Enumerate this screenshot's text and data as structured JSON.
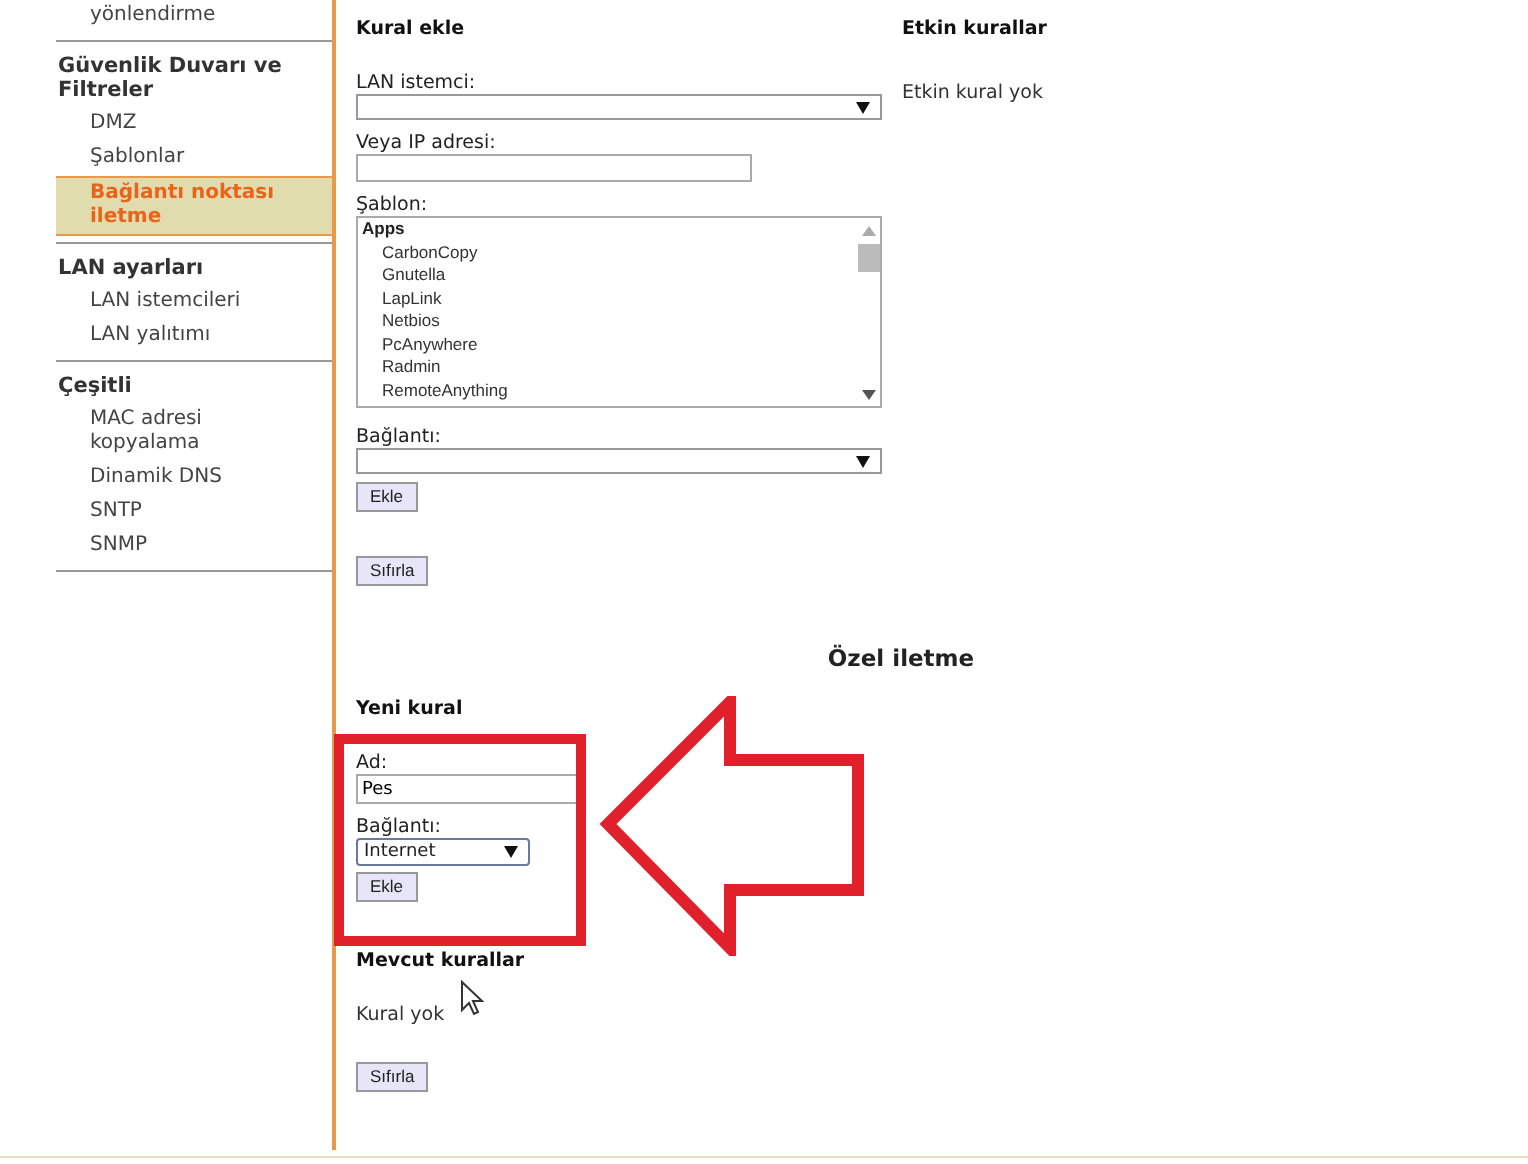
{
  "sidebar": {
    "sections": [
      {
        "items": [
          {
            "label": "yönlendirme",
            "selected": false
          }
        ]
      },
      {
        "title": "Güvenlik Duvarı ve Filtreler",
        "items": [
          {
            "label": "DMZ",
            "selected": false
          },
          {
            "label": "Şablonlar",
            "selected": false
          },
          {
            "label": "Bağlantı noktası iletme",
            "selected": true
          }
        ]
      },
      {
        "title": "LAN ayarları",
        "items": [
          {
            "label": "LAN istemcileri",
            "selected": false
          },
          {
            "label": "LAN yalıtımı",
            "selected": false
          }
        ]
      },
      {
        "title": "Çeşitli",
        "items": [
          {
            "label": "MAC adresi kopyalama",
            "selected": false
          },
          {
            "label": "Dinamik DNS",
            "selected": false
          },
          {
            "label": "SNTP",
            "selected": false
          },
          {
            "label": "SNMP",
            "selected": false
          }
        ]
      }
    ]
  },
  "add_rule": {
    "title": "Kural ekle",
    "lan_client": {
      "label": "LAN istemci:"
    },
    "ip_address": {
      "label": "Veya IP adresi:"
    },
    "template": {
      "label": "Şablon:",
      "group": "Apps",
      "options": [
        {
          "label": "CarbonCopy",
          "selected": false
        },
        {
          "label": "Gnutella",
          "selected": false
        },
        {
          "label": "LapLink",
          "selected": false
        },
        {
          "label": "Netbios",
          "selected": false
        },
        {
          "label": "PcAnywhere",
          "selected": false
        },
        {
          "label": "Radmin",
          "selected": false
        },
        {
          "label": "RemoteAnything",
          "selected": false
        }
      ]
    },
    "connection": {
      "label": "Bağlantı:"
    },
    "add_button": "Ekle",
    "reset_button": "Sıfırla"
  },
  "active_rules": {
    "title": "Etkin kurallar",
    "empty_text": "Etkin kural yok"
  },
  "custom_forwarding": {
    "title": "Özel iletme",
    "new_rule": {
      "title": "Yeni kural",
      "name": {
        "label": "Ad:",
        "value": "Pes"
      },
      "connection": {
        "label": "Bağlantı:",
        "value": "Internet"
      },
      "add_button": "Ekle"
    },
    "existing_rules": {
      "title": "Mevcut kurallar",
      "empty_text": "Kural yok",
      "reset_button": "Sıfırla"
    }
  },
  "annotation": {
    "highlight_box": true,
    "arrow": true
  }
}
